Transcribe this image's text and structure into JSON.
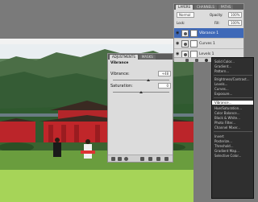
{
  "layers_panel": {
    "tabs": [
      "LAYERS",
      "CHANNELS",
      "PATHS"
    ],
    "blend_mode": "Normal",
    "opacity_label": "Opacity:",
    "opacity_value": "100%",
    "lock_label": "Lock:",
    "fill_label": "Fill:",
    "fill_value": "100%",
    "layers": [
      {
        "name": "Vibrance 1"
      },
      {
        "name": "Curves 1"
      },
      {
        "name": "Levels 1"
      }
    ]
  },
  "adjustments_panel": {
    "tabs": [
      "ADJUSTMENTS",
      "MASKS"
    ],
    "title": "Vibrance",
    "vibrance_label": "Vibrance:",
    "vibrance_value": "+48",
    "saturation_label": "Saturation:",
    "saturation_value": "0"
  },
  "adjustment_menu": {
    "items": [
      "Solid Color...",
      "Gradient...",
      "Pattern...",
      "Brightness/Contrast...",
      "Levels...",
      "Curves...",
      "Exposure...",
      "Vibrance...",
      "Hue/Saturation...",
      "Color Balance...",
      "Black & White...",
      "Photo Filter...",
      "Channel Mixer...",
      "Invert",
      "Posterize...",
      "Threshold...",
      "Gradient Map...",
      "Selective Color..."
    ],
    "highlighted_item": "Vibrance..."
  }
}
